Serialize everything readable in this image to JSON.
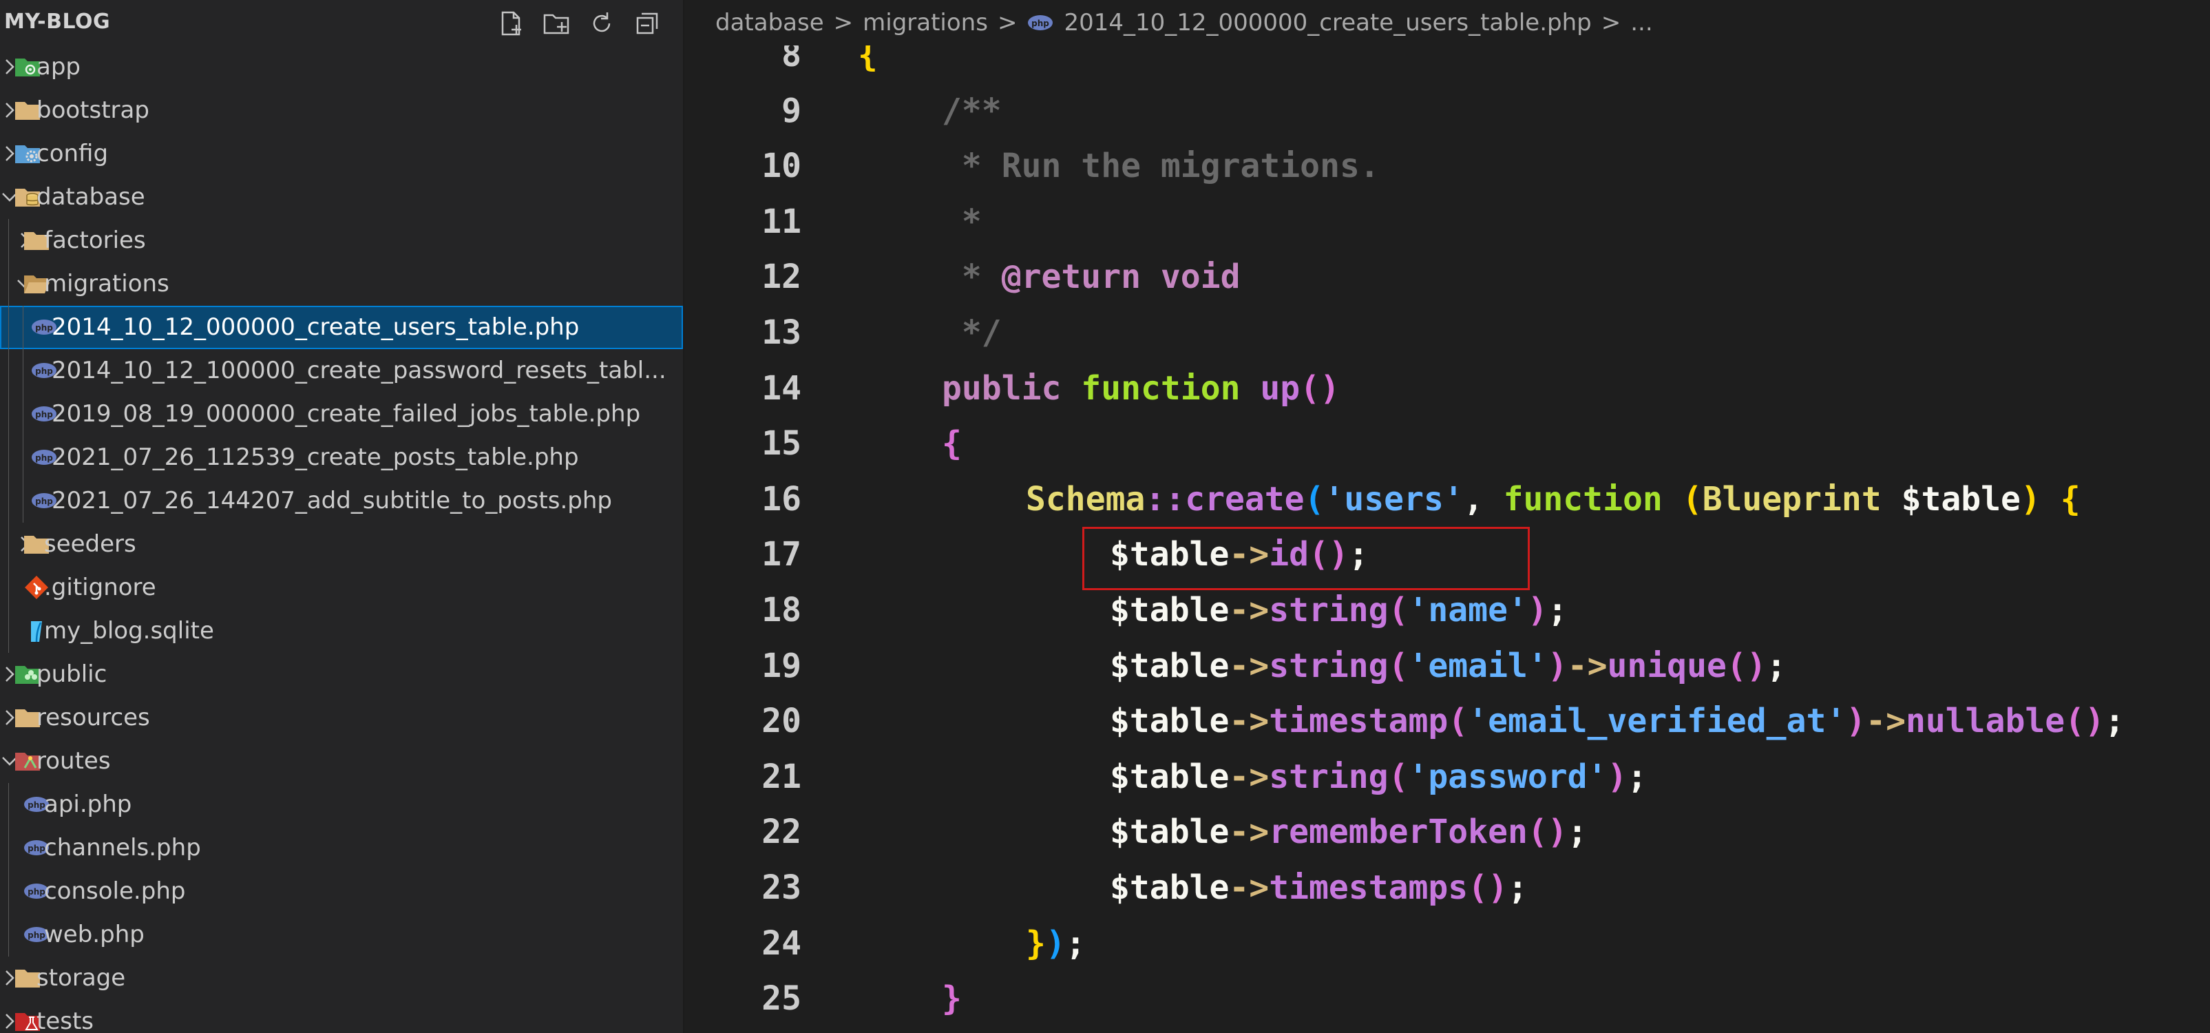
{
  "explorer": {
    "title": "MY-BLOG",
    "actions": [
      {
        "name": "new-file-button",
        "icon": "new-file-icon"
      },
      {
        "name": "new-folder-button",
        "icon": "new-folder-icon"
      },
      {
        "name": "refresh-button",
        "icon": "refresh-icon"
      },
      {
        "name": "collapse-all-button",
        "icon": "collapse-all-icon"
      }
    ],
    "tree": [
      {
        "label": "app",
        "type": "folder",
        "icon": "app-folder-icon",
        "depth": 0,
        "expanded": false
      },
      {
        "label": "bootstrap",
        "type": "folder",
        "icon": "folder-icon",
        "depth": 0,
        "expanded": false
      },
      {
        "label": "config",
        "type": "folder",
        "icon": "config-folder-icon",
        "depth": 0,
        "expanded": false
      },
      {
        "label": "database",
        "type": "folder",
        "icon": "database-folder-icon",
        "depth": 0,
        "expanded": true
      },
      {
        "label": "factories",
        "type": "folder",
        "icon": "folder-icon",
        "depth": 1,
        "expanded": false
      },
      {
        "label": "migrations",
        "type": "folder",
        "icon": "folder-open-icon",
        "depth": 1,
        "expanded": true
      },
      {
        "label": "2014_10_12_000000_create_users_table.php",
        "type": "file",
        "icon": "php-icon",
        "depth": 2,
        "selected": true
      },
      {
        "label": "2014_10_12_100000_create_password_resets_tabl...",
        "type": "file",
        "icon": "php-icon",
        "depth": 2
      },
      {
        "label": "2019_08_19_000000_create_failed_jobs_table.php",
        "type": "file",
        "icon": "php-icon",
        "depth": 2
      },
      {
        "label": "2021_07_26_112539_create_posts_table.php",
        "type": "file",
        "icon": "php-icon",
        "depth": 2
      },
      {
        "label": "2021_07_26_144207_add_subtitle_to_posts.php",
        "type": "file",
        "icon": "php-icon",
        "depth": 2
      },
      {
        "label": "seeders",
        "type": "folder",
        "icon": "folder-icon",
        "depth": 1,
        "expanded": false
      },
      {
        "label": ".gitignore",
        "type": "file",
        "icon": "git-icon",
        "depth": 1
      },
      {
        "label": "my_blog.sqlite",
        "type": "file",
        "icon": "sqlite-icon",
        "depth": 1
      },
      {
        "label": "public",
        "type": "folder",
        "icon": "public-folder-icon",
        "depth": 0,
        "expanded": false
      },
      {
        "label": "resources",
        "type": "folder",
        "icon": "folder-icon",
        "depth": 0,
        "expanded": false
      },
      {
        "label": "routes",
        "type": "folder",
        "icon": "routes-folder-icon",
        "depth": 0,
        "expanded": true
      },
      {
        "label": "api.php",
        "type": "file",
        "icon": "php-icon",
        "depth": 1
      },
      {
        "label": "channels.php",
        "type": "file",
        "icon": "php-icon",
        "depth": 1
      },
      {
        "label": "console.php",
        "type": "file",
        "icon": "php-icon",
        "depth": 1
      },
      {
        "label": "web.php",
        "type": "file",
        "icon": "php-icon",
        "depth": 1
      },
      {
        "label": "storage",
        "type": "folder",
        "icon": "folder-icon",
        "depth": 0,
        "expanded": false
      },
      {
        "label": "tests",
        "type": "folder",
        "icon": "tests-folder-icon",
        "depth": 0,
        "expanded": false
      }
    ]
  },
  "breadcrumb": {
    "segments": [
      "database",
      "migrations",
      "2014_10_12_000000_create_users_table.php",
      "..."
    ],
    "file_icon": "php-icon"
  },
  "editor": {
    "line_numbers": [
      "8",
      "9",
      "10",
      "11",
      "12",
      "13",
      "14",
      "15",
      "16",
      "17",
      "18",
      "19",
      "20",
      "21",
      "22",
      "23",
      "24",
      "25"
    ],
    "lines": [
      {
        "indent": 0,
        "tokens": [
          [
            "{",
            "brace-y"
          ]
        ]
      },
      {
        "indent": 1,
        "tokens": [
          [
            "/**",
            "comment"
          ]
        ]
      },
      {
        "indent": 1,
        "tokens": [
          [
            " * Run the migrations.",
            "comment"
          ]
        ]
      },
      {
        "indent": 1,
        "tokens": [
          [
            " *",
            "comment"
          ]
        ]
      },
      {
        "indent": 1,
        "tokens": [
          [
            " * ",
            "comment"
          ],
          [
            "@return",
            "tag"
          ],
          [
            " void",
            "tag"
          ]
        ]
      },
      {
        "indent": 1,
        "tokens": [
          [
            " */",
            "comment"
          ]
        ]
      },
      {
        "indent": 1,
        "tokens": [
          [
            "public ",
            "kw"
          ],
          [
            "function ",
            "fn"
          ],
          [
            "up",
            "method"
          ],
          [
            "()",
            "brace-p"
          ]
        ]
      },
      {
        "indent": 1,
        "tokens": [
          [
            "{",
            "brace-p"
          ]
        ]
      },
      {
        "indent": 2,
        "tokens": [
          [
            "Schema",
            "class"
          ],
          [
            "::",
            "op"
          ],
          [
            "create",
            "method"
          ],
          [
            "(",
            "brace-b"
          ],
          [
            "'users'",
            "str"
          ],
          [
            ", ",
            "punct"
          ],
          [
            "function ",
            "fn"
          ],
          [
            "(",
            "brace-y"
          ],
          [
            "Blueprint ",
            "class"
          ],
          [
            "$table",
            "var"
          ],
          [
            ") ",
            "brace-y"
          ],
          [
            "{",
            "brace-y"
          ]
        ]
      },
      {
        "indent": 3,
        "tokens": [
          [
            "$table",
            "var"
          ],
          [
            "->",
            "arrow"
          ],
          [
            "id",
            "method"
          ],
          [
            "()",
            "brace-p"
          ],
          [
            ";",
            "punct"
          ]
        ]
      },
      {
        "indent": 3,
        "tokens": [
          [
            "$table",
            "var"
          ],
          [
            "->",
            "arrow"
          ],
          [
            "string",
            "method"
          ],
          [
            "(",
            "brace-p"
          ],
          [
            "'name'",
            "str"
          ],
          [
            ")",
            "brace-p"
          ],
          [
            ";",
            "punct"
          ]
        ]
      },
      {
        "indent": 3,
        "tokens": [
          [
            "$table",
            "var"
          ],
          [
            "->",
            "arrow"
          ],
          [
            "string",
            "method"
          ],
          [
            "(",
            "brace-p"
          ],
          [
            "'email'",
            "str"
          ],
          [
            ")",
            "brace-p"
          ],
          [
            "->",
            "arrow"
          ],
          [
            "unique",
            "method"
          ],
          [
            "()",
            "brace-p"
          ],
          [
            ";",
            "punct"
          ]
        ]
      },
      {
        "indent": 3,
        "tokens": [
          [
            "$table",
            "var"
          ],
          [
            "->",
            "arrow"
          ],
          [
            "timestamp",
            "method"
          ],
          [
            "(",
            "brace-p"
          ],
          [
            "'email_verified_at'",
            "str"
          ],
          [
            ")",
            "brace-p"
          ],
          [
            "->",
            "arrow"
          ],
          [
            "nullable",
            "method"
          ],
          [
            "()",
            "brace-p"
          ],
          [
            ";",
            "punct"
          ]
        ]
      },
      {
        "indent": 3,
        "tokens": [
          [
            "$table",
            "var"
          ],
          [
            "->",
            "arrow"
          ],
          [
            "string",
            "method"
          ],
          [
            "(",
            "brace-p"
          ],
          [
            "'password'",
            "str"
          ],
          [
            ")",
            "brace-p"
          ],
          [
            ";",
            "punct"
          ]
        ]
      },
      {
        "indent": 3,
        "tokens": [
          [
            "$table",
            "var"
          ],
          [
            "->",
            "arrow"
          ],
          [
            "rememberToken",
            "method"
          ],
          [
            "()",
            "brace-p"
          ],
          [
            ";",
            "punct"
          ]
        ]
      },
      {
        "indent": 3,
        "tokens": [
          [
            "$table",
            "var"
          ],
          [
            "->",
            "arrow"
          ],
          [
            "timestamps",
            "method"
          ],
          [
            "()",
            "brace-p"
          ],
          [
            ";",
            "punct"
          ]
        ]
      },
      {
        "indent": 2,
        "tokens": [
          [
            "}",
            "brace-y"
          ],
          [
            ")",
            "brace-b"
          ],
          [
            ";",
            "punct"
          ]
        ]
      },
      {
        "indent": 1,
        "tokens": [
          [
            "}",
            "brace-p"
          ]
        ]
      }
    ]
  },
  "colors": {
    "sidebar_bg": "#252526",
    "editor_bg": "#1e1e1e",
    "selection_bg": "#094771",
    "highlight_box": "#d01b1b"
  }
}
